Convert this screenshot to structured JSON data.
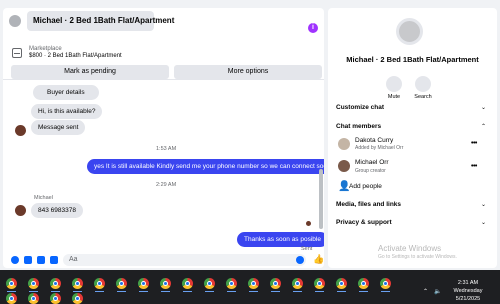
{
  "chat": {
    "title": "Michael · 2 Bed 1Bath Flat/Apartment",
    "info_icon": "info-icon",
    "listing_source": "Marketplace",
    "listing_detail": "$800 · 2 Bed 1Bath Flat/Apartment",
    "mark_pending": "Mark as pending",
    "more_options": "More options",
    "messages": {
      "buyer_details": "Buyer details",
      "is_available": "Hi, is this available?",
      "message_sent": "Message sent",
      "time1": "1:53 AM",
      "out1": "yes It is still available Kindly send me your phone number so we can connect soon",
      "time2": "2:29 AM",
      "sender_name": "Michael",
      "phone": "843 6983378",
      "out2": "Thanks as soon as posible",
      "sent_status": "Sent"
    },
    "composer_placeholder": "Aa"
  },
  "sidebar": {
    "name": "Michael · 2 Bed 1Bath Flat/Apartment",
    "mute_label": "Mute",
    "search_label": "Search",
    "customize_chat": "Customize chat",
    "chat_members": "Chat members",
    "members": [
      {
        "name": "Dakota Curry",
        "sub": "Added by Michael Orr"
      },
      {
        "name": "Michael Orr",
        "sub": "Group creator"
      }
    ],
    "add_people": "Add people",
    "media": "Media, files and links",
    "privacy": "Privacy & support"
  },
  "watermark": {
    "title": "Activate Windows",
    "sub": "Go to Settings to activate Windows."
  },
  "taskbar": {
    "time": "2:31 AM",
    "day": "Wednesday",
    "date": "5/21/2025",
    "icon_name": "chrome-icon"
  },
  "colors": {
    "accent": "#3a45f0",
    "info": "#a033ff",
    "link": "#0866ff"
  }
}
